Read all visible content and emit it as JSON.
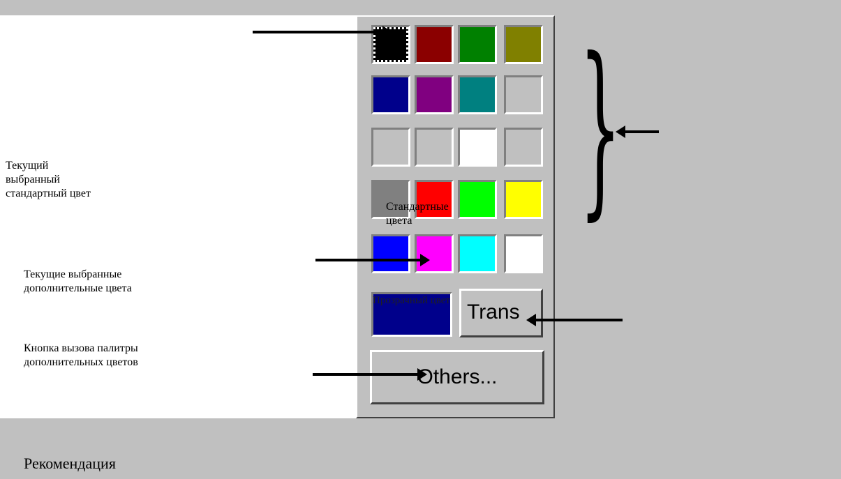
{
  "labels": {
    "current_standard": [
      "Текущий",
      "выбранный",
      "стандартный цвет"
    ],
    "current_extra": [
      "Текущие выбранные",
      "дополнительные цвета"
    ],
    "others_hint": [
      "Кнопка вызова палитры",
      "дополнительных цветов"
    ],
    "standard_colors": "Стандартные цвета",
    "transparent_color": "Прозрачный цвет"
  },
  "buttons": {
    "trans": "Trans",
    "others": "Others..."
  },
  "footer": "Рекомендация",
  "colors": {
    "rows": [
      [
        "#000000",
        "#8b0000",
        "#008000",
        "#808000"
      ],
      [
        "#00008b",
        "#800080",
        "#008080",
        "#c0c0c0"
      ],
      [
        "#c0c0c0",
        "#c0c0c0",
        "#ffffff",
        "#c0c0c0"
      ],
      [
        "#808080",
        "#ff0000",
        "#00ff00",
        "#ffff00"
      ],
      [
        "#0000ff",
        "#ff00ff",
        "#00ffff",
        "#ffffff"
      ]
    ],
    "transparent": "#00008b",
    "background": "#c0c0c0"
  }
}
